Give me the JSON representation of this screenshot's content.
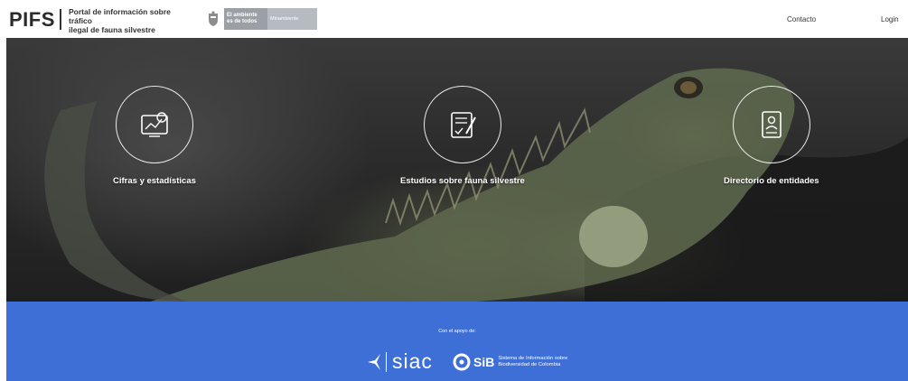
{
  "header": {
    "logo": "PIFS",
    "subtitle_line1": "Portal de información sobre tráfico",
    "subtitle_line2": "ilegal de fauna silvestre",
    "gov_box1_line1": "El ambiente",
    "gov_box1_line2": "es de todos",
    "gov_box2": "Minambiente",
    "nav": {
      "contacto": "Contacto",
      "login": "Login"
    }
  },
  "hero": {
    "features": [
      {
        "label": "Cifras y estadísticas",
        "icon": "statistics-icon"
      },
      {
        "label": "Estudios sobre fauna silvestre",
        "icon": "studies-icon"
      },
      {
        "label": "Directorio de entidades",
        "icon": "directory-icon"
      }
    ]
  },
  "footer": {
    "support_text": "Con el apoyo de:",
    "siac": "siac",
    "sib": "SiB",
    "sib_sub_line1": "Sistema de Información sobre",
    "sib_sub_line2": "Biodiversidad de Colombia",
    "color": "#3d6fd6"
  }
}
